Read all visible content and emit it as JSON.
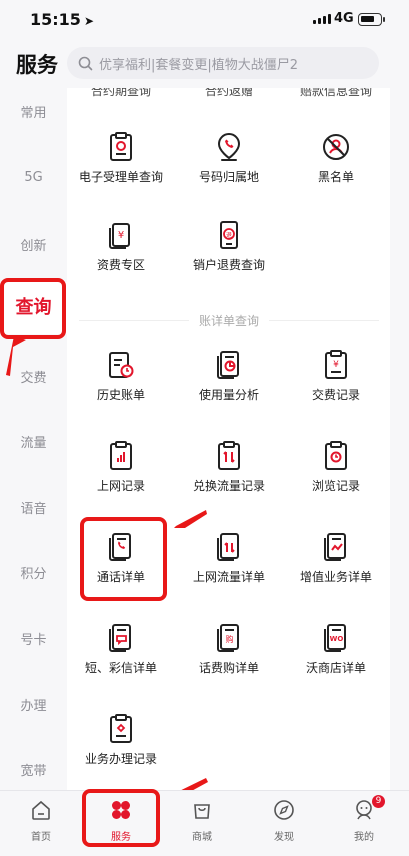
{
  "status_bar": {
    "time": "15:15",
    "location_arrow": "➤",
    "network": "4G"
  },
  "header": {
    "title": "服务",
    "search_placeholder": "优享福利|套餐变更|植物大战僵尸2"
  },
  "sidebar": {
    "items": [
      {
        "label": "常用"
      },
      {
        "label": "5G"
      },
      {
        "label": "创新"
      },
      {
        "label": "查询"
      },
      {
        "label": "交费"
      },
      {
        "label": "流量"
      },
      {
        "label": "语音"
      },
      {
        "label": "积分"
      },
      {
        "label": "号卡"
      },
      {
        "label": "办理"
      },
      {
        "label": "宽带"
      }
    ],
    "active_index": 3
  },
  "content": {
    "partial_top": [
      "合约期查询",
      "合约返赠",
      "赔款信息查询"
    ],
    "group1": [
      {
        "label": "电子受理单查询",
        "icon": "receipt-icon"
      },
      {
        "label": "号码归属地",
        "icon": "location-pin-icon"
      },
      {
        "label": "黑名单",
        "icon": "blocked-user-icon"
      },
      {
        "label": "资费专区",
        "icon": "tariff-icon"
      },
      {
        "label": "销户退费查询",
        "icon": "refund-phone-icon"
      }
    ],
    "section_title": "账详单查询",
    "group2": [
      {
        "label": "历史账单",
        "icon": "history-bill-icon"
      },
      {
        "label": "使用量分析",
        "icon": "usage-analysis-icon"
      },
      {
        "label": "交费记录",
        "icon": "payment-record-icon"
      },
      {
        "label": "上网记录",
        "icon": "internet-record-icon"
      },
      {
        "label": "兑换流量记录",
        "icon": "exchange-data-icon"
      },
      {
        "label": "浏览记录",
        "icon": "browse-record-icon"
      },
      {
        "label": "通话详单",
        "icon": "call-detail-icon"
      },
      {
        "label": "上网流量详单",
        "icon": "data-detail-icon"
      },
      {
        "label": "增值业务详单",
        "icon": "value-added-icon"
      },
      {
        "label": "短、彩信详单",
        "icon": "sms-detail-icon"
      },
      {
        "label": "话费购详单",
        "icon": "phone-purchase-icon"
      },
      {
        "label": "沃商店详单",
        "icon": "wo-store-icon"
      },
      {
        "label": "业务办理记录",
        "icon": "business-record-icon"
      }
    ]
  },
  "tabbar": {
    "items": [
      {
        "label": "首页",
        "icon": "home-icon"
      },
      {
        "label": "服务",
        "icon": "service-icon"
      },
      {
        "label": "商城",
        "icon": "shopping-bag-icon"
      },
      {
        "label": "发现",
        "icon": "compass-icon"
      },
      {
        "label": "我的",
        "icon": "profile-icon"
      }
    ],
    "active_index": 1,
    "mine_badge": "9"
  },
  "colors": {
    "accent": "#e2162c",
    "highlight": "#e81818"
  }
}
